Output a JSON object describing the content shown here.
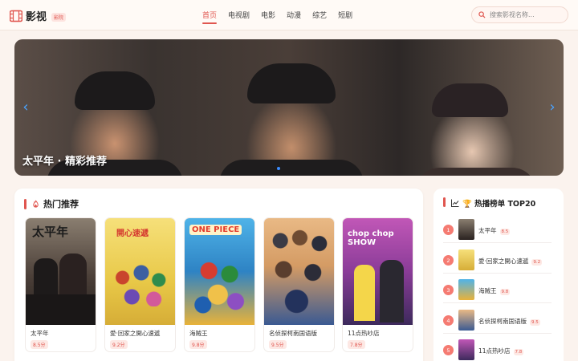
{
  "header": {
    "logo_text": "影视",
    "logo_tag": "影院",
    "nav": [
      "首页",
      "电视剧",
      "电影",
      "动漫",
      "综艺",
      "短剧"
    ],
    "search_placeholder": "搜索影视名称..."
  },
  "banner": {
    "title": "太平年 · 精彩推荐",
    "prev_icon": "chevron-left-icon",
    "next_icon": "chevron-right-icon"
  },
  "recommend": {
    "title": "热门推荐",
    "icon": "fire-icon",
    "items": [
      {
        "name": "太平年",
        "score": "8.5分",
        "poster_text": "太平年",
        "colors": [
          "#7c6e62",
          "#3a302c"
        ]
      },
      {
        "name": "愛·回家之開心速遞",
        "score": "9.2分",
        "poster_text": "開心速遞",
        "colors": [
          "#f2d862",
          "#d8b83e"
        ]
      },
      {
        "name": "海贼王",
        "score": "9.8分",
        "poster_text": "ONE PIECE",
        "colors": [
          "#3aa0d8",
          "#e9c23a"
        ]
      },
      {
        "name": "名侦探柯南国语版",
        "score": "9.5分",
        "poster_text": "",
        "colors": [
          "#e6b27a",
          "#3b5f9a"
        ]
      },
      {
        "name": "11点热吵店",
        "score": "7.8分",
        "poster_text": "chop chop SHOW",
        "colors": [
          "#b64bb0",
          "#5a2f7e"
        ]
      }
    ]
  },
  "ranking": {
    "title": "🏆 热播榜单 TOP20",
    "icon": "chart-icon",
    "items": [
      {
        "rank": "1",
        "name": "太平年",
        "score": "8.5",
        "colors": [
          "#7c6e62",
          "#3a302c"
        ]
      },
      {
        "rank": "2",
        "name": "愛·回家之開心速遞",
        "score": "9.2",
        "colors": [
          "#f2d862",
          "#d8b83e"
        ]
      },
      {
        "rank": "3",
        "name": "海贼王",
        "score": "9.8",
        "colors": [
          "#3aa0d8",
          "#e9c23a"
        ]
      },
      {
        "rank": "4",
        "name": "名侦探柯南国语版",
        "score": "9.5",
        "colors": [
          "#e6b27a",
          "#3b5f9a"
        ]
      },
      {
        "rank": "5",
        "name": "11点热吵店",
        "score": "7.8",
        "colors": [
          "#b64bb0",
          "#5a2f7e"
        ]
      }
    ]
  },
  "colors": {
    "accent": "#e0564f",
    "background": "#fbf3ee"
  }
}
